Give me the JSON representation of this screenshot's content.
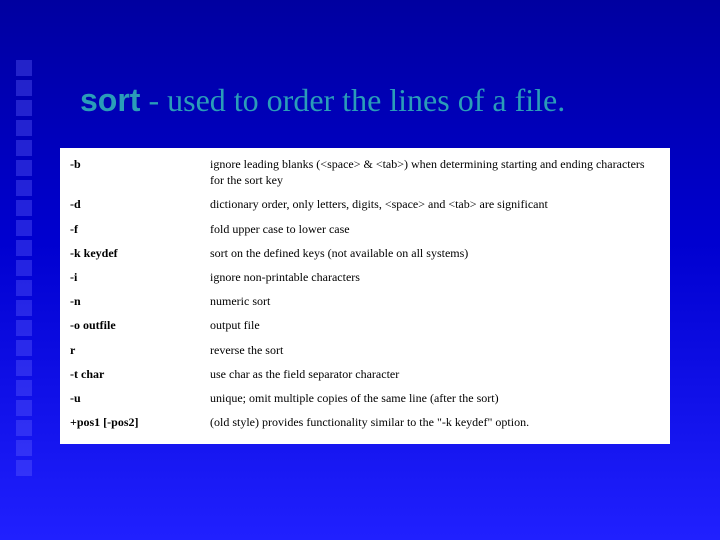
{
  "title": {
    "cmd": "sort",
    "rest": " - used to order the lines of a file."
  },
  "options": [
    {
      "flag": "-b",
      "desc": "ignore leading blanks (<space> & <tab>) when determining starting and ending characters for the sort key"
    },
    {
      "flag": "-d",
      "desc": "dictionary order, only letters, digits, <space> and <tab> are significant"
    },
    {
      "flag": "-f",
      "desc": "fold upper case to lower case"
    },
    {
      "flag": "-k keydef",
      "desc": "sort on the defined keys (not available on all systems)"
    },
    {
      "flag": "-i",
      "desc": "ignore non-printable characters"
    },
    {
      "flag": "-n",
      "desc": "numeric sort"
    },
    {
      "flag": "-o outfile",
      "desc": "output file"
    },
    {
      "flag": "r",
      "desc": "reverse the sort"
    },
    {
      "flag": "-t char",
      "desc": "use char as the field separator character"
    },
    {
      "flag": "-u",
      "desc": "unique; omit multiple copies of the same line (after the sort)"
    },
    {
      "flag": "+pos1 [-pos2]",
      "desc": "(old style) provides functionality similar to the \"-k keydef\" option."
    }
  ]
}
